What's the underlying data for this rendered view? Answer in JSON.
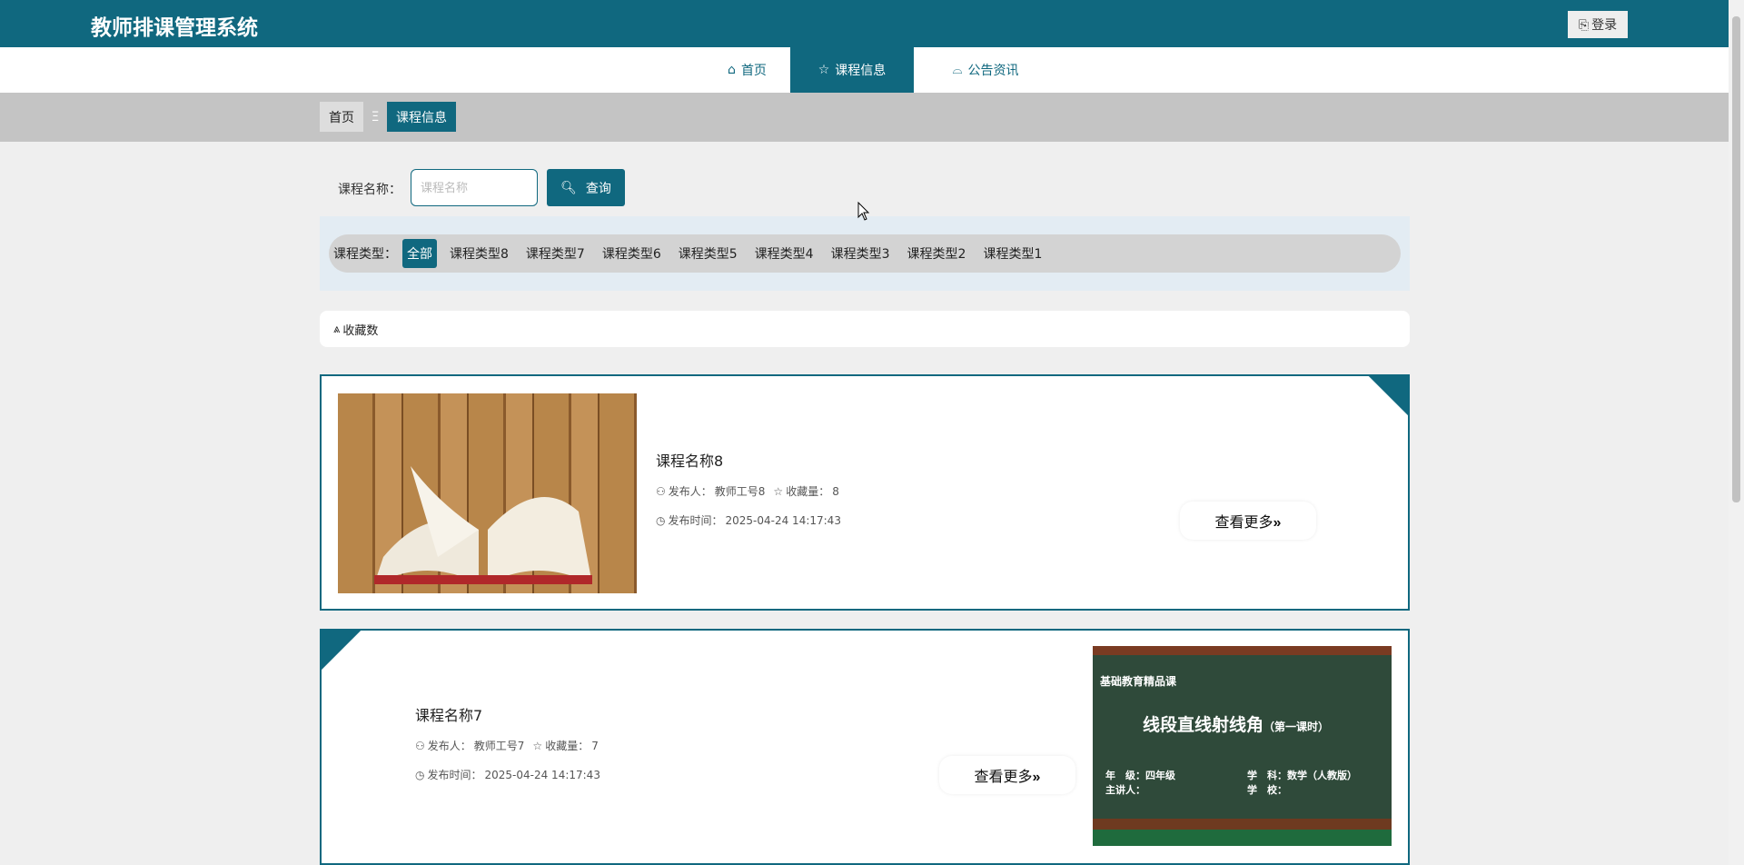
{
  "header": {
    "title": "教师排课管理系统",
    "login_label": "登录"
  },
  "nav": {
    "items": [
      {
        "label": "首页"
      },
      {
        "label": "课程信息"
      },
      {
        "label": "公告资讯"
      }
    ],
    "active": 1
  },
  "breadcrumb": {
    "home": "首页",
    "separator": "Ξ",
    "current": "课程信息"
  },
  "search": {
    "label": "课程名称：",
    "placeholder": "课程名称",
    "value": "",
    "button": "查询"
  },
  "filter": {
    "label": "课程类型：",
    "types": [
      "全部",
      "课程类型8",
      "课程类型7",
      "课程类型6",
      "课程类型5",
      "课程类型4",
      "课程类型3",
      "课程类型2",
      "课程类型1"
    ],
    "active": 0
  },
  "sort": {
    "label": "收藏数"
  },
  "courses": [
    {
      "name": "课程名称8",
      "publisher_label": "发布人：",
      "publisher": "教师工号8",
      "fav_label": "收藏量：",
      "fav": "8",
      "time_label": "发布时间：",
      "time": "2025-04-24 14:17:43",
      "more": "查看更多"
    },
    {
      "name": "课程名称7",
      "publisher_label": "发布人：",
      "publisher": "教师工号7",
      "fav_label": "收藏量：",
      "fav": "7",
      "time_label": "发布时间：",
      "time": "2025-04-24 14:17:43",
      "more": "查看更多",
      "image_text": {
        "series": "基础教育精品课",
        "title": "线段直线射线角",
        "lesson": "（第一课时）",
        "grade": "年　级：四年级",
        "subject": "学　科：数学（人教版）",
        "lecturer": "主讲人：",
        "school": "学　校："
      }
    }
  ],
  "colors": {
    "primary": "#10687f",
    "background": "#efefef",
    "breadcrumb_bg": "#c4c4c4"
  }
}
